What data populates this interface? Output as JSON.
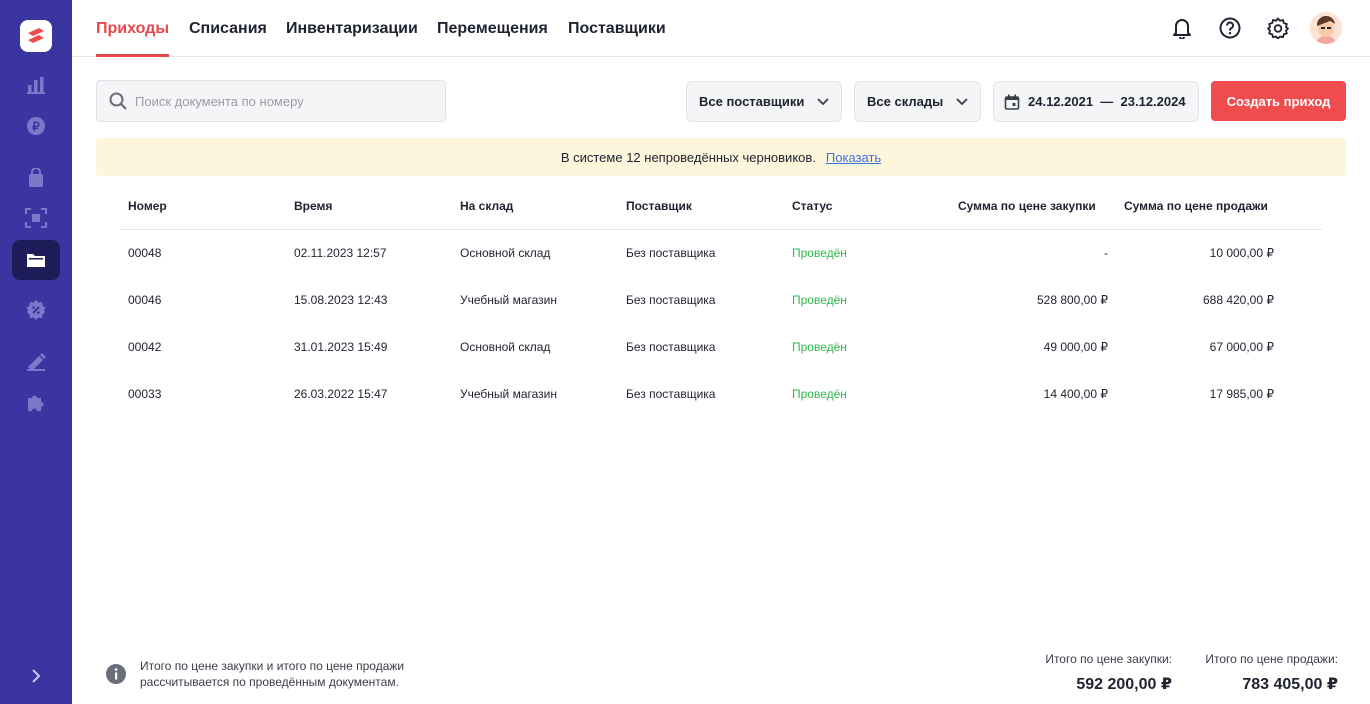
{
  "nav": {
    "tabs": [
      {
        "label": "Приходы",
        "active": true
      },
      {
        "label": "Списания"
      },
      {
        "label": "Инвентаризации"
      },
      {
        "label": "Перемещения"
      },
      {
        "label": "Поставщики"
      }
    ]
  },
  "sidebar": {
    "icons": [
      "logo-icon",
      "analytics-icon",
      "finance-icon",
      "shop-bag-icon",
      "scan-icon",
      "warehouse-folder-icon",
      "discount-icon",
      "marketing-icon",
      "integrations-icon",
      "expand-icon"
    ],
    "active": "warehouse-folder-icon"
  },
  "toolbar": {
    "search_placeholder": "Поиск документа по номеру",
    "supplier_filter": "Все поставщики",
    "warehouse_filter": "Все склады",
    "date_range": "24.12.2021  —  23.12.2024",
    "create_label": "Создать приход"
  },
  "banner": {
    "text": "В системе 12 непроведённых черновиков.",
    "link": "Показать"
  },
  "table": {
    "headers": [
      "Номер",
      "Время",
      "На склад",
      "Поставщик",
      "Статус",
      "Сумма по цене закупки",
      "Сумма по цене продажи"
    ],
    "rows": [
      {
        "number": "00048",
        "time": "02.11.2023 12:57",
        "warehouse": "Основной склад",
        "supplier": "Без поставщика",
        "status": "Проведён",
        "purchase": "-",
        "sale": "10 000,00 ₽"
      },
      {
        "number": "00046",
        "time": "15.08.2023 12:43",
        "warehouse": "Учебный магазин",
        "supplier": "Без поставщика",
        "status": "Проведён",
        "purchase": "528 800,00 ₽",
        "sale": "688 420,00 ₽"
      },
      {
        "number": "00042",
        "time": "31.01.2023 15:49",
        "warehouse": "Основной склад",
        "supplier": "Без поставщика",
        "status": "Проведён",
        "purchase": "49 000,00 ₽",
        "sale": "67 000,00 ₽"
      },
      {
        "number": "00033",
        "time": "26.03.2022 15:47",
        "warehouse": "Учебный магазин",
        "supplier": "Без поставщика",
        "status": "Проведён",
        "purchase": "14 400,00 ₽",
        "sale": "17 985,00 ₽"
      }
    ]
  },
  "footer": {
    "info": "Итого по цене закупки и итого по цене продажи рассчитывается по проведённым документам.",
    "purchase_label": "Итого по цене закупки:",
    "purchase_total": "592 200,00 ₽",
    "sale_label": "Итого по цене продажи:",
    "sale_total": "783 405,00 ₽"
  },
  "colors": {
    "sidebar": "#3a35a0",
    "accent": "#e5484d",
    "status_ok": "#2db84c",
    "banner": "#fdf5dc",
    "link": "#3f72d8"
  }
}
